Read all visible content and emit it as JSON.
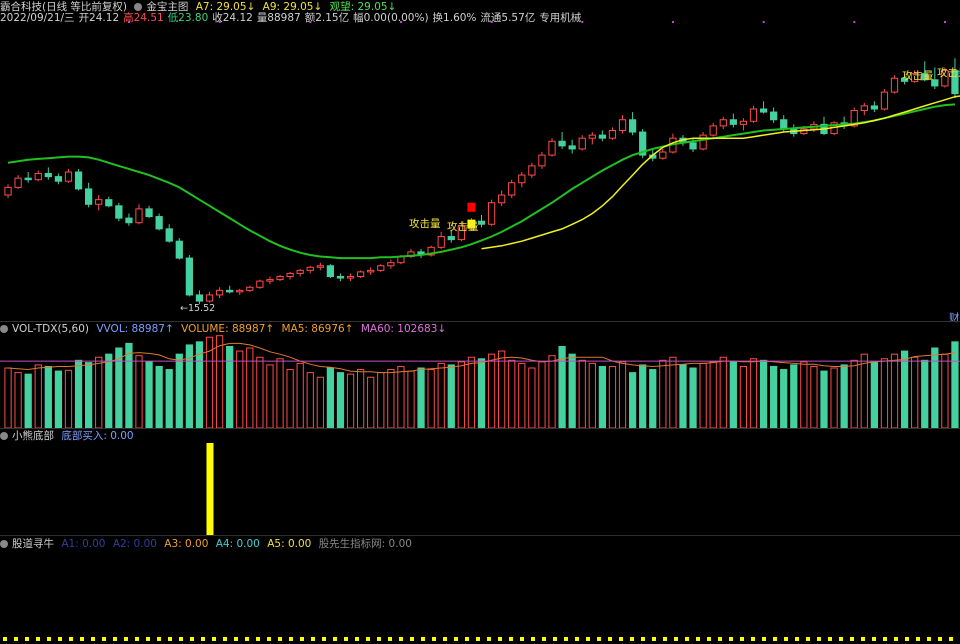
{
  "colors": {
    "up": "#ff4b4b",
    "down": "#45d0a0",
    "ma_green": "#20c020",
    "ma_yellow": "#f0f020",
    "vol_ma5": "#e07830",
    "vol_ma60": "#c050c0",
    "signal": "#ffff00",
    "magenta_dot": "#d040d0"
  },
  "header1": {
    "name": "霸合科技(日线 等比前复权)",
    "indicator": "金宝主图",
    "a7": "A7: 29.05↓",
    "a9": "A9: 29.05↓",
    "watch": "观望: 29.05↓"
  },
  "header2": {
    "date": "2022/09/21/三",
    "open": "开24.12",
    "high": "高24.51",
    "low": "低23.80",
    "close": "收24.12",
    "volume": "量88987",
    "amount": "额2.15亿",
    "amplitude": "幅0.00(0.00%)",
    "turnover": "换1.60%",
    "float": "流通5.57亿",
    "industry": "专用机械"
  },
  "price_labels": {
    "low_marker": "←15.52",
    "attack1": "攻击量",
    "attack2": "攻击量",
    "attack3": "攻击量",
    "attack4": "攻击量",
    "right_edge": "财"
  },
  "vol_header": {
    "title": "VOL-TDX(5,60)",
    "vvol": "VVOL: 88987↑",
    "volume": "VOLUME: 88987↑",
    "ma5": "MA5: 86976↑",
    "ma60": "MA60: 102683↓"
  },
  "sub1_header": {
    "title": "小熊底部",
    "buy": "底部买入: 0.00"
  },
  "sub2_header": {
    "title": "股道寻牛",
    "a1": "A1: 0.00",
    "a2": "A2: 0.00",
    "a3": "A3: 0.00",
    "a4": "A4: 0.00",
    "a5": "A5: 0.00",
    "a6": "股先生指标网: 0.00"
  },
  "chart_data": {
    "type": "candlestick",
    "candles": [
      [
        17.5,
        18.2,
        17.3,
        18.0
      ],
      [
        18.0,
        18.8,
        17.9,
        18.6
      ],
      [
        18.6,
        19.0,
        18.3,
        18.5
      ],
      [
        18.5,
        19.1,
        18.4,
        18.9
      ],
      [
        18.9,
        19.3,
        18.5,
        18.7
      ],
      [
        18.7,
        18.9,
        18.2,
        18.4
      ],
      [
        18.4,
        19.2,
        18.3,
        19.0
      ],
      [
        19.0,
        19.2,
        17.8,
        17.9
      ],
      [
        17.9,
        18.3,
        16.7,
        16.9
      ],
      [
        16.9,
        17.5,
        16.5,
        17.2
      ],
      [
        17.2,
        17.4,
        16.7,
        16.8
      ],
      [
        16.8,
        17.0,
        15.8,
        16.0
      ],
      [
        16.0,
        16.3,
        15.5,
        15.7
      ],
      [
        15.7,
        16.9,
        15.6,
        16.6
      ],
      [
        16.6,
        16.8,
        16.0,
        16.1
      ],
      [
        16.1,
        16.3,
        15.2,
        15.3
      ],
      [
        15.3,
        15.6,
        14.4,
        14.5
      ],
      [
        14.5,
        14.7,
        13.3,
        13.4
      ],
      [
        13.4,
        13.6,
        10.9,
        11.0
      ],
      [
        11.0,
        11.3,
        10.4,
        10.6
      ],
      [
        10.6,
        11.2,
        10.5,
        11.0
      ],
      [
        11.0,
        11.5,
        10.8,
        11.3
      ],
      [
        11.3,
        11.6,
        11.1,
        11.2
      ],
      [
        11.2,
        11.4,
        11.0,
        11.3
      ],
      [
        11.3,
        11.6,
        11.2,
        11.5
      ],
      [
        11.5,
        12.0,
        11.4,
        11.9
      ],
      [
        11.9,
        12.2,
        11.7,
        12.0
      ],
      [
        12.0,
        12.3,
        11.9,
        12.2
      ],
      [
        12.2,
        12.5,
        12.0,
        12.4
      ],
      [
        12.4,
        12.7,
        12.2,
        12.6
      ],
      [
        12.6,
        12.9,
        12.4,
        12.8
      ],
      [
        12.8,
        13.1,
        12.6,
        12.9
      ],
      [
        12.9,
        13.0,
        12.1,
        12.2
      ],
      [
        12.2,
        12.4,
        11.9,
        12.1
      ],
      [
        12.1,
        12.4,
        11.9,
        12.2
      ],
      [
        12.2,
        12.6,
        12.1,
        12.5
      ],
      [
        12.5,
        12.8,
        12.3,
        12.6
      ],
      [
        12.6,
        13.0,
        12.5,
        12.9
      ],
      [
        12.9,
        13.3,
        12.7,
        13.1
      ],
      [
        13.1,
        13.6,
        13.0,
        13.5
      ],
      [
        13.5,
        14.0,
        13.4,
        13.8
      ],
      [
        13.8,
        14.0,
        13.4,
        13.6
      ],
      [
        13.6,
        14.2,
        13.5,
        14.1
      ],
      [
        14.1,
        15.1,
        14.0,
        14.8
      ],
      [
        14.8,
        15.2,
        14.4,
        14.6
      ],
      [
        14.6,
        15.8,
        14.5,
        15.5
      ],
      [
        15.5,
        16.0,
        15.2,
        15.8
      ],
      [
        15.8,
        16.2,
        15.4,
        15.6
      ],
      [
        15.6,
        17.2,
        15.5,
        17.0
      ],
      [
        17.0,
        17.8,
        16.8,
        17.5
      ],
      [
        17.5,
        18.5,
        17.3,
        18.3
      ],
      [
        18.3,
        19.0,
        18.0,
        18.8
      ],
      [
        18.8,
        19.6,
        18.6,
        19.4
      ],
      [
        19.4,
        20.3,
        19.2,
        20.1
      ],
      [
        20.1,
        21.2,
        20.0,
        21.0
      ],
      [
        21.0,
        21.6,
        20.5,
        20.7
      ],
      [
        20.7,
        21.1,
        20.2,
        20.5
      ],
      [
        20.5,
        21.4,
        20.4,
        21.2
      ],
      [
        21.2,
        21.6,
        20.8,
        21.4
      ],
      [
        21.4,
        21.7,
        21.0,
        21.2
      ],
      [
        21.2,
        21.9,
        21.1,
        21.7
      ],
      [
        21.7,
        22.7,
        21.5,
        22.4
      ],
      [
        22.4,
        22.9,
        21.4,
        21.6
      ],
      [
        21.6,
        21.8,
        19.9,
        20.1
      ],
      [
        20.1,
        20.5,
        19.7,
        19.9
      ],
      [
        19.9,
        20.5,
        19.8,
        20.3
      ],
      [
        20.3,
        21.5,
        20.2,
        21.2
      ],
      [
        21.2,
        21.4,
        20.7,
        20.9
      ],
      [
        20.9,
        21.2,
        20.3,
        20.5
      ],
      [
        20.5,
        21.6,
        20.4,
        21.4
      ],
      [
        21.4,
        22.2,
        21.3,
        22.0
      ],
      [
        22.0,
        22.6,
        21.8,
        22.4
      ],
      [
        22.4,
        22.8,
        21.9,
        22.1
      ],
      [
        22.1,
        22.5,
        21.7,
        22.3
      ],
      [
        22.3,
        23.3,
        22.2,
        23.1
      ],
      [
        23.1,
        23.6,
        22.8,
        22.9
      ],
      [
        22.9,
        23.2,
        22.2,
        22.4
      ],
      [
        22.4,
        22.7,
        21.6,
        21.8
      ],
      [
        21.8,
        22.1,
        21.3,
        21.5
      ],
      [
        21.5,
        22.0,
        21.4,
        21.8
      ],
      [
        21.8,
        22.3,
        21.6,
        22.1
      ],
      [
        22.1,
        22.6,
        21.4,
        21.5
      ],
      [
        21.5,
        22.3,
        21.4,
        22.2
      ],
      [
        22.2,
        22.6,
        21.8,
        22.0
      ],
      [
        22.0,
        23.2,
        21.9,
        23.0
      ],
      [
        23.0,
        23.5,
        22.7,
        23.3
      ],
      [
        23.3,
        23.6,
        22.9,
        23.1
      ],
      [
        23.1,
        24.4,
        23.0,
        24.2
      ],
      [
        24.2,
        25.3,
        24.1,
        25.1
      ],
      [
        25.1,
        25.4,
        24.7,
        24.9
      ],
      [
        24.9,
        25.6,
        24.8,
        25.4
      ],
      [
        25.4,
        26.2,
        24.9,
        25.0
      ],
      [
        25.0,
        25.8,
        24.4,
        24.6
      ],
      [
        24.6,
        25.8,
        24.5,
        25.6
      ],
      [
        25.6,
        26.4,
        23.8,
        24.1
      ]
    ],
    "ma_green": [
      19.6,
      19.7,
      19.8,
      19.85,
      19.9,
      19.95,
      20.0,
      20.0,
      19.95,
      19.8,
      19.6,
      19.4,
      19.2,
      19.0,
      18.8,
      18.55,
      18.3,
      18.0,
      17.6,
      17.2,
      16.8,
      16.4,
      16.0,
      15.6,
      15.2,
      14.85,
      14.5,
      14.2,
      13.95,
      13.75,
      13.6,
      13.5,
      13.45,
      13.4,
      13.4,
      13.4,
      13.4,
      13.45,
      13.45,
      13.5,
      13.55,
      13.6,
      13.7,
      13.8,
      13.95,
      14.1,
      14.3,
      14.55,
      14.8,
      15.1,
      15.45,
      15.8,
      16.2,
      16.6,
      17.0,
      17.45,
      17.9,
      18.3,
      18.7,
      19.1,
      19.45,
      19.8,
      20.1,
      20.3,
      20.5,
      20.65,
      20.8,
      20.9,
      21.0,
      21.1,
      21.2,
      21.3,
      21.4,
      21.5,
      21.6,
      21.7,
      21.75,
      21.8,
      21.85,
      21.9,
      21.95,
      22.0,
      22.05,
      22.1,
      22.15,
      22.25,
      22.35,
      22.5,
      22.65,
      22.8,
      22.95,
      23.1,
      23.25,
      23.35,
      23.4
    ],
    "ma_yellow": [
      null,
      null,
      null,
      null,
      null,
      null,
      null,
      null,
      null,
      null,
      null,
      null,
      null,
      null,
      null,
      null,
      null,
      null,
      null,
      null,
      null,
      null,
      null,
      null,
      null,
      null,
      null,
      null,
      null,
      null,
      null,
      null,
      null,
      null,
      null,
      null,
      null,
      null,
      null,
      null,
      null,
      null,
      null,
      null,
      null,
      null,
      null,
      14.0,
      14.1,
      14.2,
      14.35,
      14.5,
      14.7,
      14.9,
      15.1,
      15.3,
      15.6,
      15.9,
      16.3,
      16.8,
      17.4,
      18.1,
      18.8,
      19.5,
      20.1,
      20.6,
      20.9,
      21.1,
      21.2,
      21.2,
      21.2,
      21.2,
      21.2,
      21.2,
      21.3,
      21.4,
      21.5,
      21.6,
      21.65,
      21.7,
      21.75,
      21.8,
      21.9,
      22.0,
      22.1,
      22.2,
      22.35,
      22.5,
      22.7,
      22.9,
      23.1,
      23.3,
      23.5,
      23.7,
      23.9,
      24.0,
      24.1
    ],
    "volume": [
      78,
      72,
      70,
      82,
      80,
      74,
      75,
      88,
      85,
      92,
      96,
      104,
      110,
      94,
      86,
      80,
      76,
      96,
      108,
      112,
      118,
      120,
      106,
      100,
      104,
      92,
      82,
      90,
      76,
      84,
      72,
      66,
      78,
      72,
      70,
      76,
      66,
      72,
      76,
      80,
      74,
      78,
      76,
      84,
      82,
      86,
      92,
      90,
      96,
      100,
      88,
      84,
      78,
      86,
      94,
      106,
      96,
      88,
      84,
      80,
      80,
      86,
      72,
      82,
      76,
      88,
      92,
      82,
      78,
      84,
      86,
      92,
      86,
      80,
      90,
      88,
      80,
      76,
      82,
      86,
      80,
      74,
      78,
      82,
      88,
      96,
      86,
      90,
      96,
      100,
      92,
      88,
      104,
      96,
      112
    ],
    "vol_ma5": [
      78,
      77,
      76,
      78,
      79,
      80,
      80,
      81,
      82,
      84,
      86,
      90,
      97,
      98,
      97,
      95,
      90,
      88,
      91,
      96,
      100,
      107,
      110,
      110,
      108,
      104,
      99,
      96,
      92,
      87,
      83,
      80,
      79,
      77,
      74,
      73,
      73,
      72,
      72,
      73,
      74,
      76,
      77,
      78,
      79,
      81,
      84,
      85,
      88,
      91,
      92,
      91,
      88,
      86,
      87,
      90,
      92,
      92,
      92,
      92,
      87,
      84,
      82,
      81,
      80,
      81,
      82,
      83,
      84,
      84,
      85,
      87,
      87,
      86,
      86,
      87,
      86,
      85,
      84,
      83,
      83,
      81,
      80,
      80,
      81,
      84,
      86,
      87,
      88,
      89,
      93,
      94,
      95,
      96,
      98
    ],
    "vol_ma60": 87,
    "signal_bar_index": 20
  }
}
